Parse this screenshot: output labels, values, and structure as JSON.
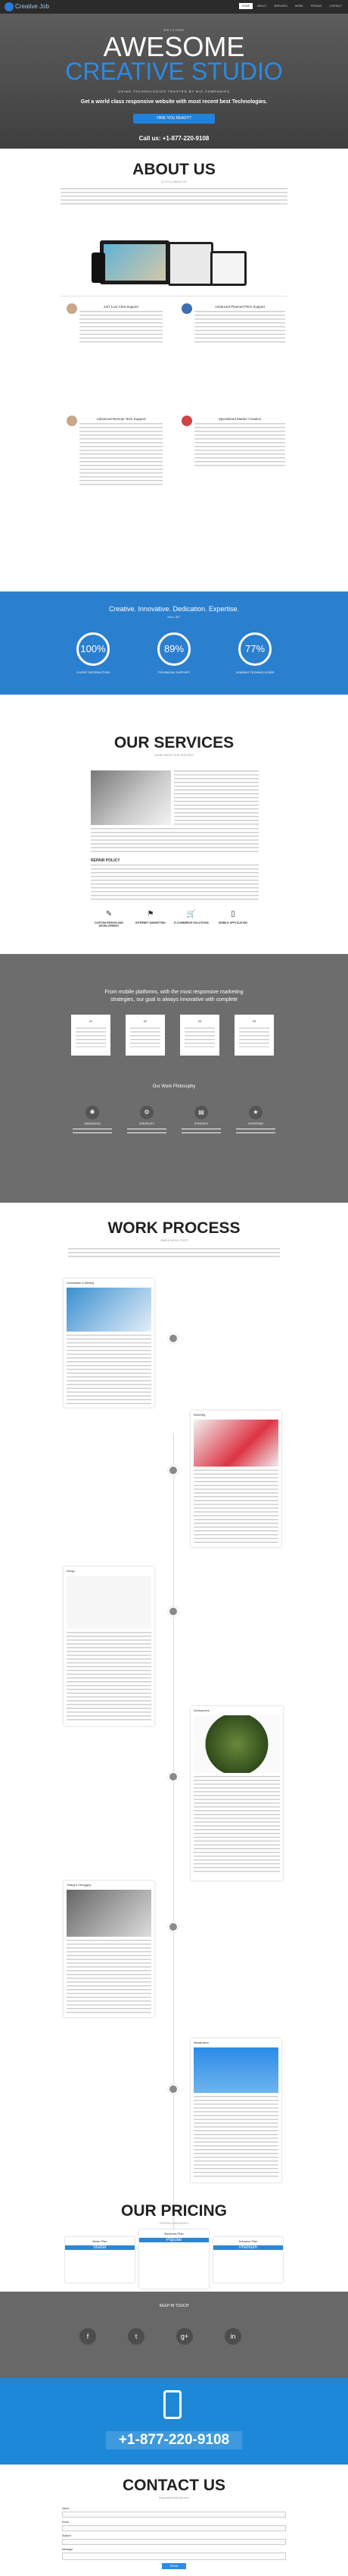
{
  "nav": {
    "brand": "Creative Job",
    "items": [
      "HOME",
      "ABOUT",
      "SERVICES",
      "WORK",
      "PRICING",
      "CONTACT"
    ]
  },
  "hero": {
    "kicker": "WELCOME",
    "title_line1": "AWESOME",
    "title_line2": "CREATIVE STUDIO",
    "tagline": "USING TECHNOLOGIES TRUSTED BY BIG COMPANIES",
    "subtitle": "Get a world class responsive website with most recent best Technologies.",
    "button": "HIRE YOU READY?",
    "call": "Call us: +1-877-220-9108"
  },
  "about": {
    "title": "ABOUT US",
    "subtitle": "A LITTLE ABOUT US",
    "features": [
      {
        "title": "24/7 Live Chat Support"
      },
      {
        "title": "Advanced Planned Pitch Support"
      },
      {
        "title": "Advanced Remote Tech Support"
      },
      {
        "title": "Specialized Marker Creation"
      }
    ]
  },
  "stats": {
    "heading": "Creative. Innovative. Dedication. Expertise.",
    "subheading": "SKILL SET",
    "items": [
      {
        "value": "100%",
        "label": "CLIENT SATISFACTION"
      },
      {
        "value": "89%",
        "label": "TECHNICAL SUPPORT"
      },
      {
        "value": "77%",
        "label": "LEADING TECHNOLOGIES"
      }
    ]
  },
  "services": {
    "title": "OUR SERVICES",
    "subtitle": "LEARN ABOUT OUR SERVICES",
    "block_heading": "REPAIR POLICY",
    "icons": [
      {
        "icon": "pencil-icon",
        "label": "CUSTOM DESIGN AND DEVELOPMENT"
      },
      {
        "icon": "flag-icon",
        "label": "INTERNET MARKETING"
      },
      {
        "icon": "cart-icon",
        "label": "E-COMMERCE SOLUTIONS"
      },
      {
        "icon": "mobile-icon",
        "label": "MOBILE APPLICATION"
      }
    ]
  },
  "strategy": {
    "heading_line1": "From mobile platforms, with the most responsive marketing",
    "heading_line2": "strategies, our goal is always innovative with complete",
    "cards": [
      "01",
      "02",
      "03",
      "04"
    ],
    "philosophy_title": "Our Work Philosophy",
    "philosophy": [
      {
        "icon": "bulb-icon",
        "label": "INNOVATION"
      },
      {
        "icon": "gear-icon",
        "label": "CREATIVITY"
      },
      {
        "icon": "chart-icon",
        "label": "STRATEGY"
      },
      {
        "icon": "star-icon",
        "label": "EXPERTISE"
      }
    ]
  },
  "work": {
    "title": "WORK PROCESS",
    "subtitle": "SIMPLE WORK STEPS",
    "steps": [
      {
        "title": "Consultation & Meeting"
      },
      {
        "title": "Sketching"
      },
      {
        "title": "Design"
      },
      {
        "title": "Development"
      },
      {
        "title": "Testing & Debugging"
      },
      {
        "title": "Maintenance"
      }
    ]
  },
  "pricing": {
    "title": "OUR PRICING",
    "subtitle": "PRICING & PACKAGES",
    "plans": [
      {
        "name": "Basic Plan",
        "head": "Starter"
      },
      {
        "name": "Business Plan",
        "head": "Popular"
      },
      {
        "name": "Advance Plan",
        "head": "Premium"
      }
    ]
  },
  "social": {
    "title": "KEEP IN TOUCH",
    "icons": [
      "facebook-icon",
      "twitter-icon",
      "google-plus-icon",
      "linkedin-icon"
    ]
  },
  "callband": {
    "phone": "+1-877-220-9108"
  },
  "contact": {
    "title": "CONTACT US",
    "subtitle": "Support@creativejob.com",
    "fields": [
      "Name",
      "Email",
      "Subject",
      "Message"
    ],
    "button": "SEND"
  },
  "colors": {
    "accent": "#2a8be8",
    "blue_band": "#2b7fcf",
    "grey_band": "#6d6d6d"
  }
}
